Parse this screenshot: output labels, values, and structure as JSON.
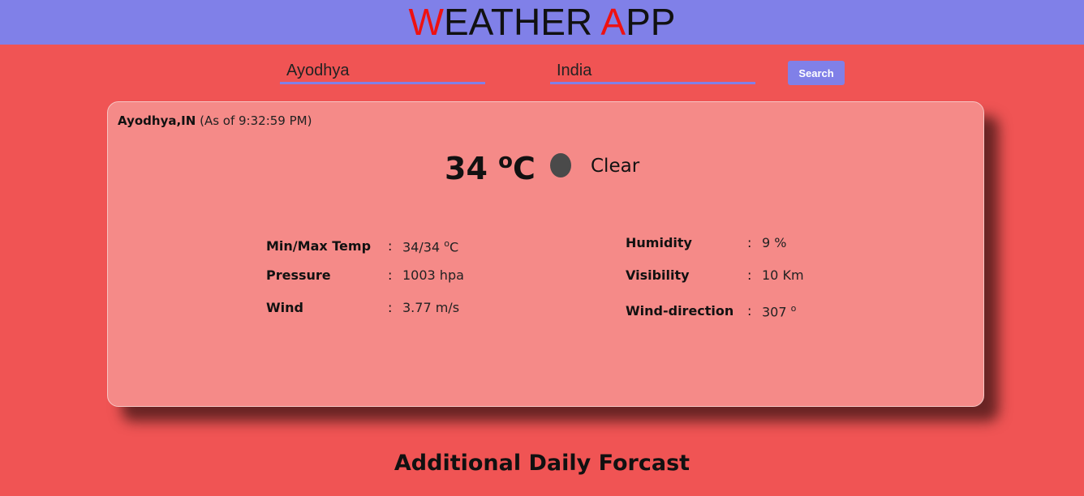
{
  "header": {
    "title_first_letter": "W",
    "title_first_rest": "EATHER ",
    "title_second_letter": "A",
    "title_second_rest": "PP",
    "background": "#8080e8",
    "accent_color": "#ee1111"
  },
  "search": {
    "city_value": "Ayodhya",
    "country_value": "India",
    "button_label": "Search"
  },
  "weather": {
    "location": "Ayodhya,IN",
    "as_of": "(As of 9:32:59 PM)",
    "temperature": "34",
    "temperature_unit": "C",
    "degree_symbol": "o",
    "condition": "Clear",
    "condition_icon": "night-clear-icon"
  },
  "details": {
    "left": [
      {
        "label": "Min/Max Temp",
        "value": "34/34",
        "unit": "C",
        "deg": "o"
      },
      {
        "label": "Pressure",
        "value": "1003 hpa"
      },
      {
        "label": "Wind",
        "value": "3.77 m/s"
      }
    ],
    "right": [
      {
        "label": "Humidity",
        "value": "9 %"
      },
      {
        "label": "Visibility",
        "value": "10 Km"
      },
      {
        "label": "Wind-direction",
        "value": "307",
        "deg": "o"
      }
    ],
    "separator": ":"
  },
  "footer": {
    "title": "Additional Daily Forcast"
  },
  "colors": {
    "page_background": "#f05454",
    "card_background": "#f58a88",
    "search_button": "#8080e8"
  }
}
